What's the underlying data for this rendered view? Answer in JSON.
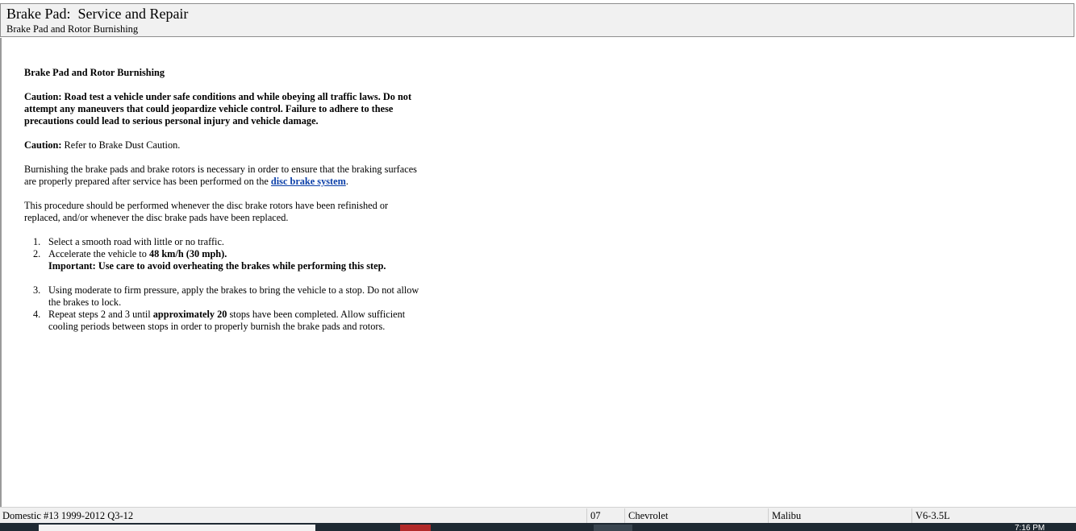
{
  "header": {
    "title": "Brake Pad:  Service and Repair",
    "subtitle": "Brake Pad and Rotor Burnishing"
  },
  "document": {
    "heading": "Brake Pad and Rotor Burnishing",
    "caution1": "Caution: Road test a vehicle under safe conditions and while obeying all traffic laws. Do not attempt any maneuvers that could jeopardize vehicle control. Failure to adhere to these precautions could lead to serious personal injury and vehicle damage.",
    "caution2_label": "Caution:",
    "caution2_text": " Refer to Brake Dust Caution.",
    "para1_before_link": "Burnishing the brake pads and brake rotors is necessary in order to ensure that the braking surfaces are properly prepared after service has been performed on the ",
    "para1_link": "disc brake system",
    "para1_after_link": ".",
    "para2": "This procedure should be performed whenever the disc brake rotors have been refinished or replaced, and/or whenever the disc brake pads have been replaced.",
    "steps": [
      {
        "num": "1.",
        "text": "Select a smooth road with little or no traffic."
      },
      {
        "num": "2.",
        "text_before": "Accelerate the vehicle to ",
        "text_bold": "48 km/h (30 mph)."
      },
      {
        "num": "3.",
        "text": "Using moderate to firm pressure, apply the brakes to bring the vehicle to a stop. Do not allow the brakes to lock."
      },
      {
        "num": "4.",
        "text_before": "Repeat steps 2 and 3 until ",
        "text_bold": "approximately 20",
        "text_after": " stops have been completed. Allow sufficient cooling periods between stops in order to properly burnish the brake pads and rotors."
      }
    ],
    "important": "Important: Use care to avoid overheating the brakes while performing this step."
  },
  "statusbar": {
    "database": "Domestic #13 1999-2012 Q3-12",
    "year": "07",
    "make": "Chevrolet",
    "model": "Malibu",
    "engine": "V6-3.5L"
  },
  "taskbar": {
    "clock": "7:16 PM"
  },
  "colors": {
    "link": "#0b3fa8",
    "header_bg": "#f1f1f1",
    "statusbar_bg": "#f0f0f0",
    "taskbar_bg": "#1f2a33"
  }
}
